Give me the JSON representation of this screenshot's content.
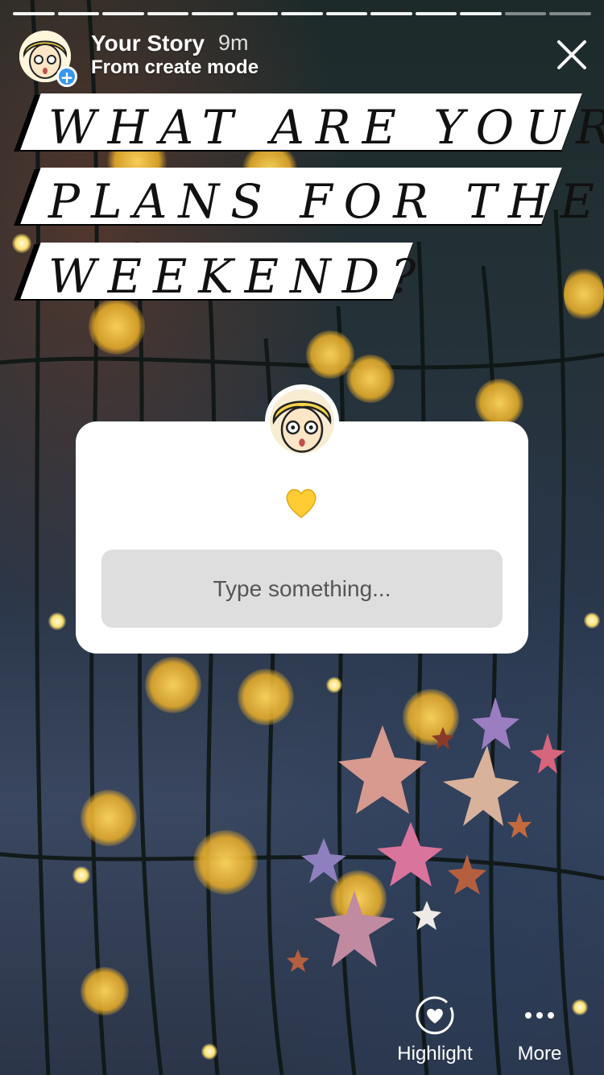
{
  "progress": {
    "total_segments": 13,
    "filled_segments": 11
  },
  "header": {
    "title": "Your Story",
    "time": "9m",
    "subtitle": "From create mode"
  },
  "headline": {
    "lines": [
      "WHAT ARE YOUR",
      "PLANS FOR THE",
      "WEEKEND?"
    ]
  },
  "question_card": {
    "emoji": "yellow-heart",
    "input_placeholder": "Type something..."
  },
  "actions": {
    "highlight_label": "Highlight",
    "more_label": "More"
  },
  "colors": {
    "badge_blue": "#3897f0",
    "heart_yellow": "#ffcc33",
    "input_bg": "#dedede"
  },
  "icons": [
    "close-icon",
    "plus-icon",
    "heart-circle-icon",
    "more-dots-icon"
  ]
}
